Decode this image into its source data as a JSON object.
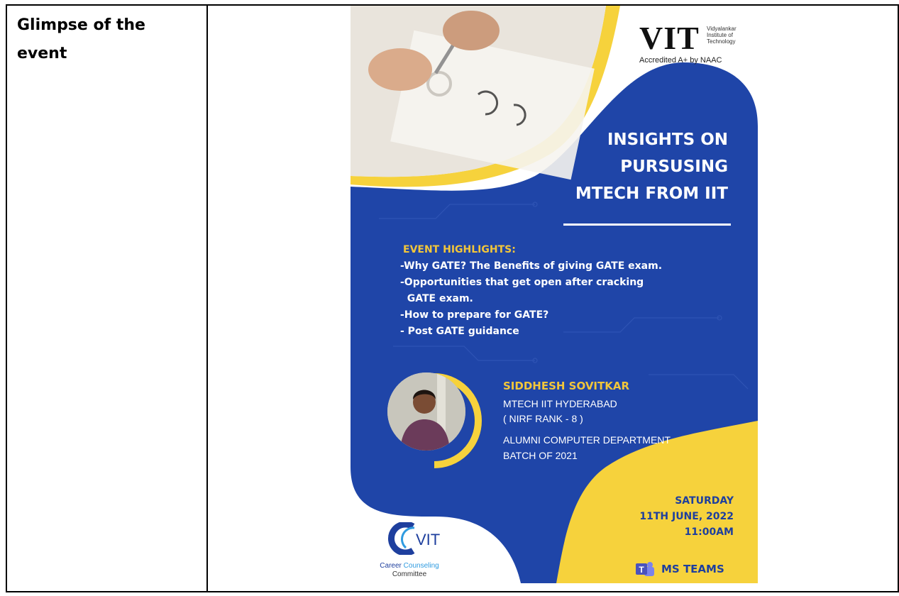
{
  "label": {
    "line1": "Glimpse of the",
    "line2": "event"
  },
  "poster": {
    "logo": {
      "letters": "VIT",
      "sub_lines": [
        "Vidyalankar",
        "Institute of",
        "Technology"
      ],
      "accreditation": "Accredited A+ by NAAC"
    },
    "title_lines": [
      "INSIGHTS ON",
      "PURSUSING",
      "MTECH FROM IIT"
    ],
    "highlights_heading": "EVENT HIGHLIGHTS:",
    "highlights": [
      "-Why GATE? The Benefits of giving GATE exam.",
      "-Opportunities that get open after cracking",
      "  GATE exam.",
      "-How to prepare for GATE?",
      "- Post GATE guidance"
    ],
    "speaker": {
      "name": "SIDDHESH SOVITKAR",
      "lines": [
        "MTECH IIT HYDERABAD",
        "( NIRF RANK - 8 )",
        "ALUMNI COMPUTER DEPARTMENT",
        "BATCH OF 2021"
      ]
    },
    "date_lines": [
      "SATURDAY",
      "11TH JUNE, 2022",
      "11:00AM"
    ],
    "platform": "MS TEAMS",
    "committee": {
      "mark_text": "VIT",
      "line1_a": "Career ",
      "line1_b": "Counseling",
      "line2": "Committee"
    },
    "colors": {
      "blue": "#1f45a8",
      "yellow": "#f6d23c",
      "white": "#ffffff"
    }
  }
}
